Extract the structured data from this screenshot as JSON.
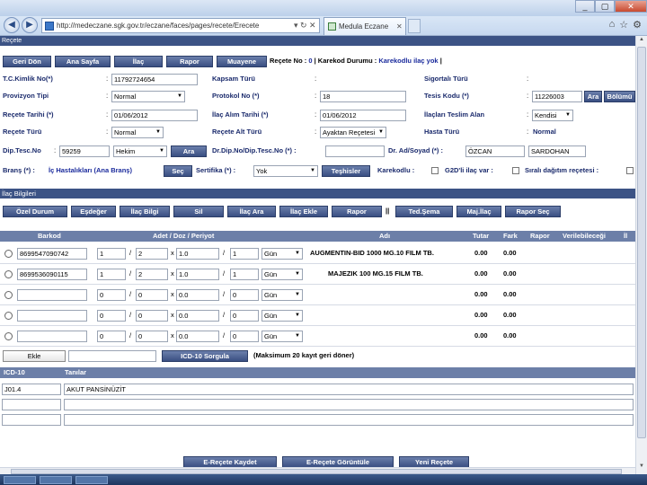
{
  "browser": {
    "url": "http://medeczane.sgk.gov.tr/eczane/faces/pages/recete/Erecete",
    "tab_title": "Medula Eczane",
    "addr_icons": "▾ ↻ ✕",
    "window_buttons": [
      "_",
      "▢",
      "✕"
    ],
    "tool_icons": [
      "⌂",
      "☆",
      "⚙"
    ]
  },
  "page_title": "Reçete",
  "toolbar": [
    "Geri Dön",
    "Ana Sayfa",
    "İlaç",
    "Rapor",
    "Muayene"
  ],
  "status": {
    "recete_no_label": "Reçete No :",
    "recete_no_value": "0",
    "karekod_label": "| Karekod Durumu :",
    "karekod_value": "Karekodlu ilaç yok",
    "end": "|"
  },
  "form": {
    "tc_label": "T.C.Kimlik No(*)",
    "tc_value": "11792724654",
    "kapsam_label": "Kapsam Türü",
    "sigortali_label": "Sigortalı Türü",
    "provizyon_label": "Provizyon Tipi",
    "provizyon_value": "Normal",
    "protokol_label": "Protokol No (*)",
    "protokol_value": "18",
    "tesis_label": "Tesis Kodu (*)",
    "tesis_value": "11226003",
    "ara_label": "Ara",
    "bolumu_label": "Bölümü",
    "recete_tarihi_label": "Reçete Tarihi (*)",
    "recete_tarihi_value": "01/06/2012",
    "ilac_alim_label": "İlaç Alım Tarihi (*)",
    "ilac_alim_value": "01/06/2012",
    "teslim_label": "İlaçları Teslim Alan",
    "teslim_value": "Kendisi",
    "recete_turu_label": "Reçete Türü",
    "recete_turu_value": "Normal",
    "alt_turu_label": "Reçete Alt Türü",
    "alt_turu_value": "Ayaktan Reçetesi",
    "hasta_turu_label": "Hasta Türü",
    "hasta_turu_value": "Normal",
    "dip_label": "Dip.Tesc.No",
    "dip_value": "59259",
    "dip_select": "Hekim",
    "dip_ara": "Ara",
    "dr_dip_label": "Dr.Dip.No/Dip.Tesc.No (*) :",
    "dr_ad_label": "Dr. Ad/Soyad (*) :",
    "dr_ad_value": "ÖZCAN",
    "dr_soyad_value": "SARDOHAN",
    "brans_label": "Branş (*) :",
    "brans_value": "İç Hastalıkları (Ana Branş)",
    "brans_sec": "Seç",
    "sertifika_label": "Sertifika (*) :",
    "sertifika_value": "Yok",
    "teshisler": "Teşhisler",
    "karekodlu_label": "Karekodlu :",
    "g2d_label": "G2D'li ilaç var :",
    "sirali_label": "Sıralı dağıtım reçetesi :"
  },
  "ilac_section": {
    "title": "İlaç Bilgileri",
    "buttons": [
      "Özel Durum",
      "Eşdeğer",
      "İlaç Bilgi",
      "Sil",
      "İlaç Ara",
      "İlaç Ekle",
      "Rapor",
      "Ted.Şema",
      "Maj.İlaç",
      "Rapor Seç"
    ],
    "separator": "||",
    "headers": [
      "Barkod",
      "Adet / Doz / Periyot",
      "Adı",
      "Tutar",
      "Fark",
      "Rapor",
      "Verilebileceği",
      "İl"
    ],
    "rows": [
      {
        "barkod": "8699547090742",
        "adet": "1",
        "doz_a": "2",
        "doz_b": "1.0",
        "periyot": "1",
        "birim": "Gün",
        "adi": "AUGMENTIN-BID 1000 MG.10 FILM TB.",
        "tutar": "0.00",
        "fark": "0.00"
      },
      {
        "barkod": "8699536090115",
        "adet": "1",
        "doz_a": "2",
        "doz_b": "1.0",
        "periyot": "1",
        "birim": "Gün",
        "adi": "MAJEZIK 100 MG.15 FILM TB.",
        "tutar": "0.00",
        "fark": "0.00"
      },
      {
        "barkod": "",
        "adet": "0",
        "doz_a": "0",
        "doz_b": "0.0",
        "periyot": "0",
        "birim": "Gün",
        "adi": "",
        "tutar": "0.00",
        "fark": "0.00"
      },
      {
        "barkod": "",
        "adet": "0",
        "doz_a": "0",
        "doz_b": "0.0",
        "periyot": "0",
        "birim": "Gün",
        "adi": "",
        "tutar": "0.00",
        "fark": "0.00"
      },
      {
        "barkod": "",
        "adet": "0",
        "doz_a": "0",
        "doz_b": "0.0",
        "periyot": "0",
        "birim": "Gün",
        "adi": "",
        "tutar": "0.00",
        "fark": "0.00"
      }
    ],
    "slash": "/",
    "x": "x"
  },
  "icd": {
    "ekle": "Ekle",
    "sorgula": "ICD-10 Sorgula",
    "max_note": "(Maksimum 20 kayıt geri döner)",
    "col_code": "ICD-10",
    "col_tani": "Tanılar",
    "rows": [
      {
        "code": "J01.4",
        "tani": "AKUT PANSİNÜZİT"
      }
    ]
  },
  "bottom_buttons": [
    "E-Reçete Kaydet",
    "E-Reçete Görüntüle",
    "Yeni Reçete"
  ]
}
